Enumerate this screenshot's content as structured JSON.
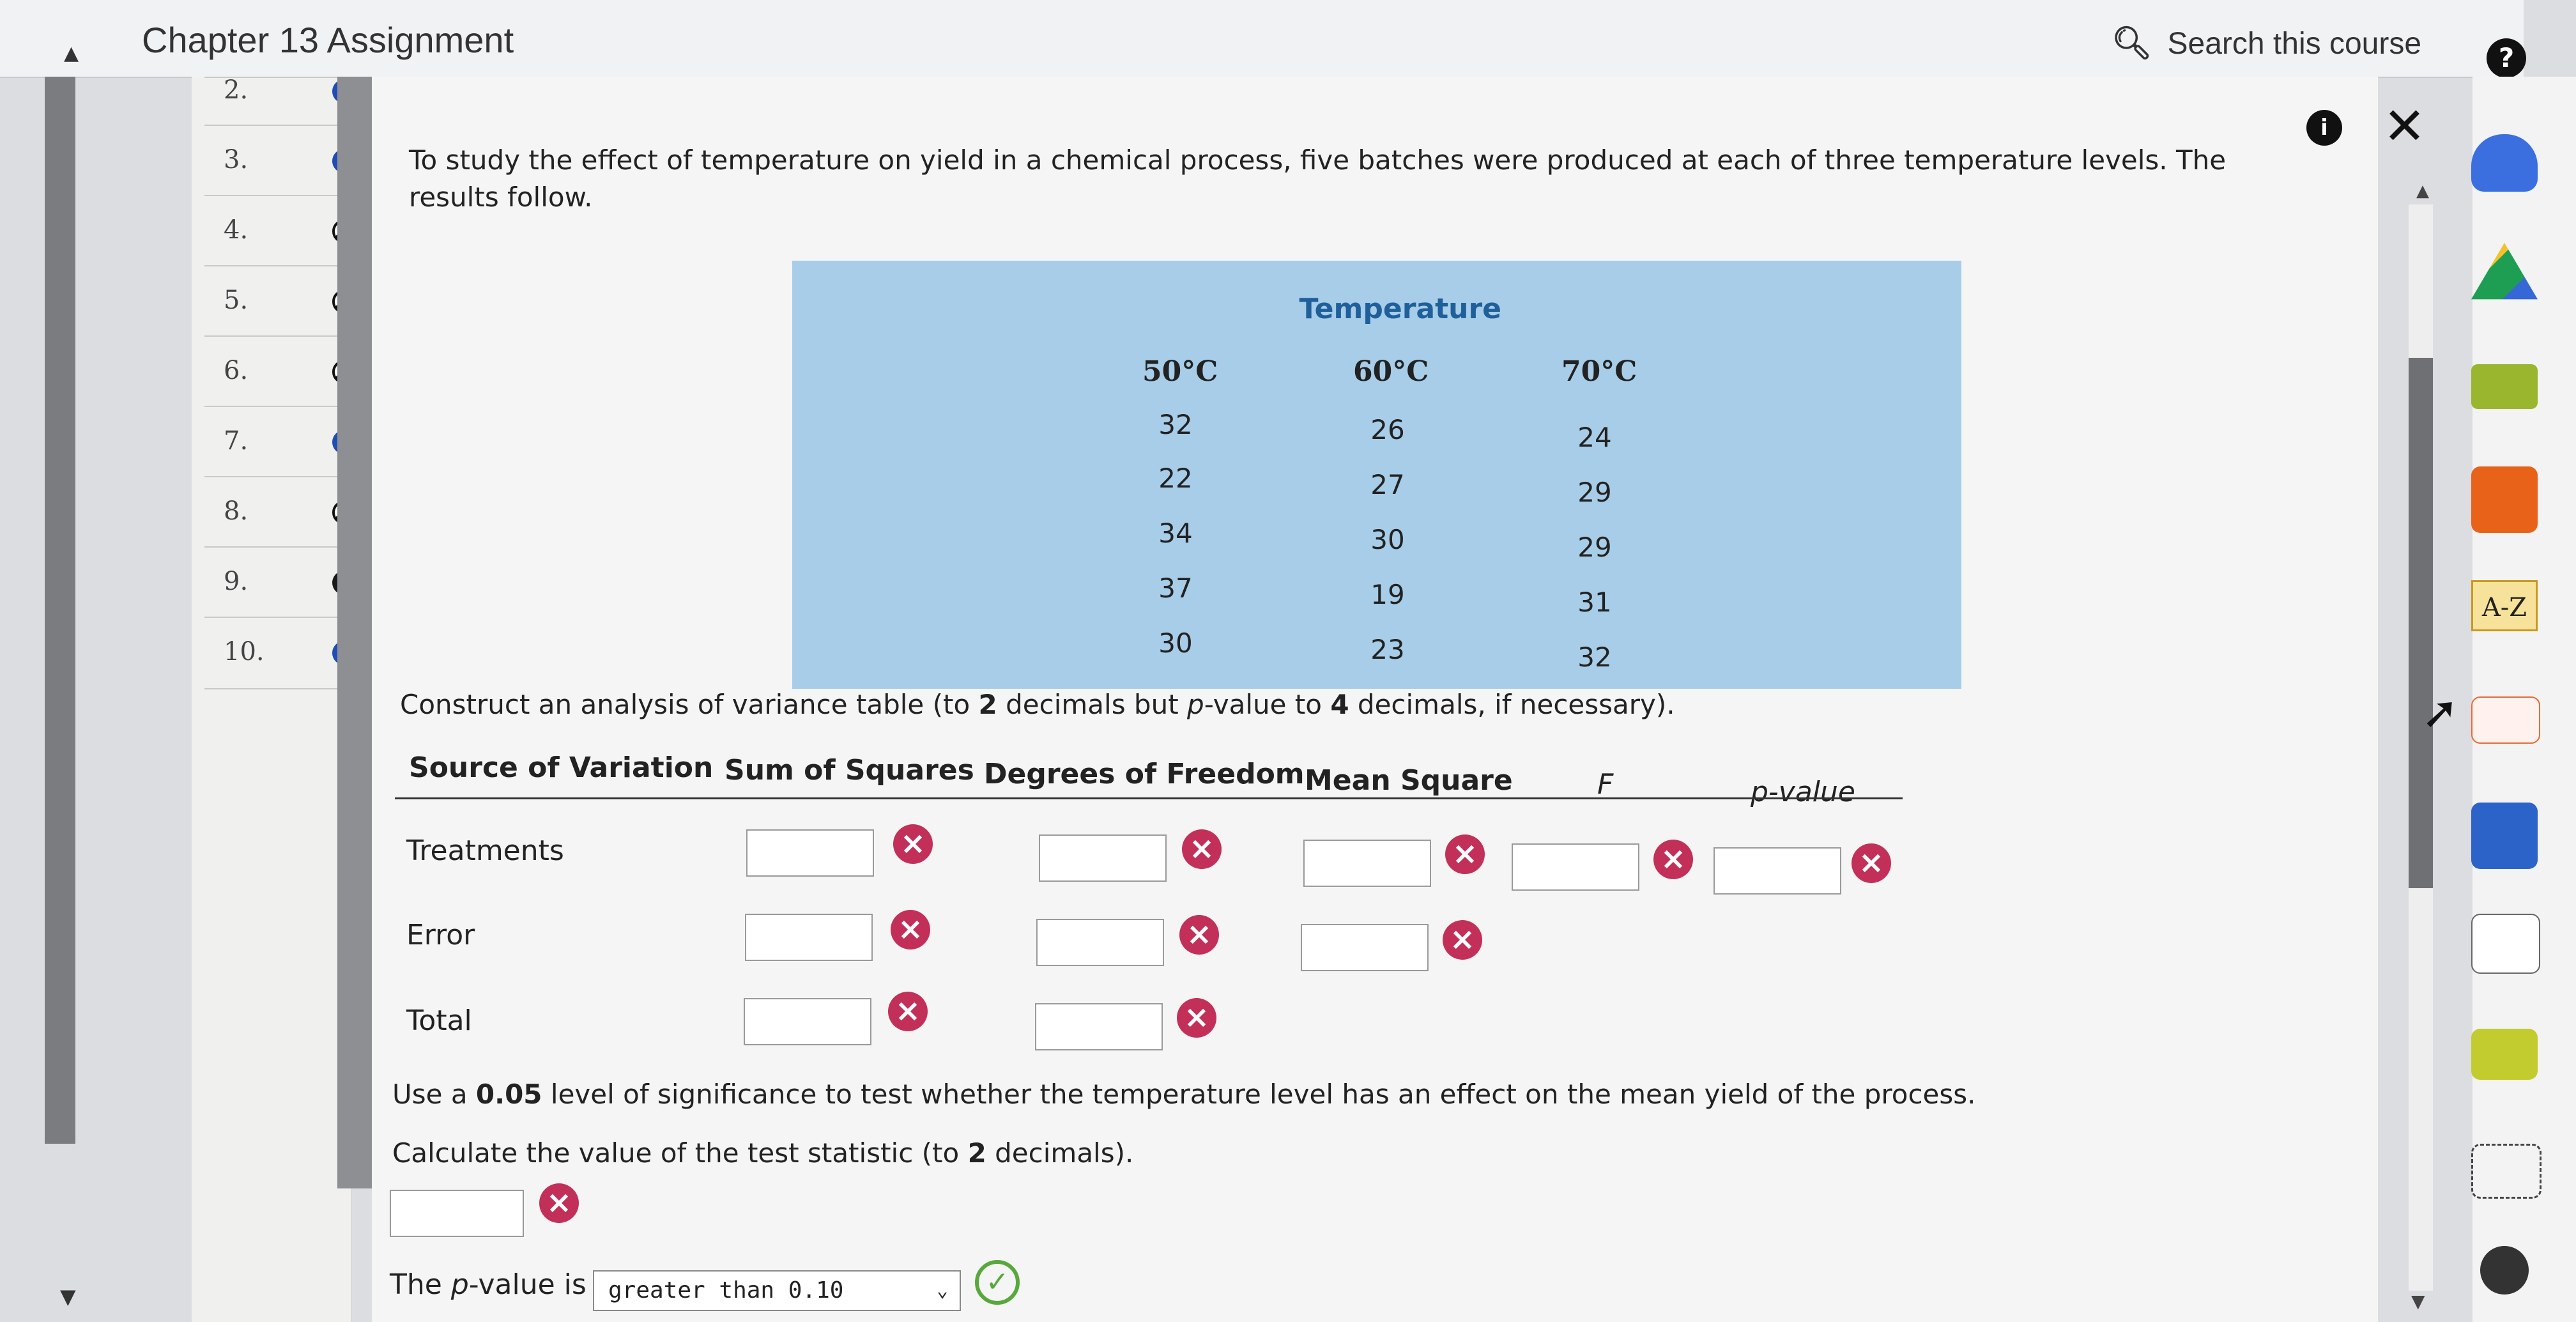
{
  "header": {
    "title": "Chapter 13 Assignment",
    "search_label": "Search this course",
    "help": "?"
  },
  "questions": [
    {
      "num": "2.",
      "status": "blue"
    },
    {
      "num": "3.",
      "status": "blue"
    },
    {
      "num": "4.",
      "status": "partial"
    },
    {
      "num": "5.",
      "status": "partial"
    },
    {
      "num": "6.",
      "status": "partial"
    },
    {
      "num": "7.",
      "status": "blue"
    },
    {
      "num": "8.",
      "status": "partial"
    },
    {
      "num": "9.",
      "status": "check"
    },
    {
      "num": "10.",
      "status": "blue"
    }
  ],
  "problem": {
    "text": "To study the effect of temperature on yield in a chemical process, five batches were produced at each of three temperature levels. The results follow.",
    "table_caption": "Temperature",
    "columns": [
      "50°C",
      "60°C",
      "70°C"
    ],
    "rows": [
      [
        "32",
        "26",
        "24"
      ],
      [
        "22",
        "27",
        "29"
      ],
      [
        "34",
        "30",
        "29"
      ],
      [
        "37",
        "19",
        "31"
      ],
      [
        "30",
        "23",
        "32"
      ]
    ]
  },
  "instruction1": {
    "pre": "Construct an analysis of variance table (to ",
    "d1": "2",
    "mid": " decimals but ",
    "p": "p",
    "mid2": "-value to ",
    "d2": "4",
    "post": " decimals, if necessary)."
  },
  "anova": {
    "headers": [
      "Source of Variation",
      "Sum of Squares",
      "Degrees of Freedom",
      "Mean Square",
      "F",
      "p-value"
    ],
    "rows": [
      "Treatments",
      "Error",
      "Total"
    ]
  },
  "instruction2": {
    "pre": "Use a ",
    "alpha": "0.05",
    "post": " level of significance to test whether the temperature level has an effect on the mean yield of the process."
  },
  "instruction3": {
    "pre": "Calculate the value of the test statistic (to ",
    "d": "2",
    "post": " decimals)."
  },
  "pvalue": {
    "label_pre": "The ",
    "label_p": "p",
    "label_post": "-value is",
    "selected": "greater than 0.10"
  },
  "right_apps": [
    "A-Z"
  ],
  "colors": {
    "accent_blue": "#1f4db8",
    "wrong": "#c2305a",
    "correct": "#58a83c",
    "table_bg": "#a7cde8"
  }
}
